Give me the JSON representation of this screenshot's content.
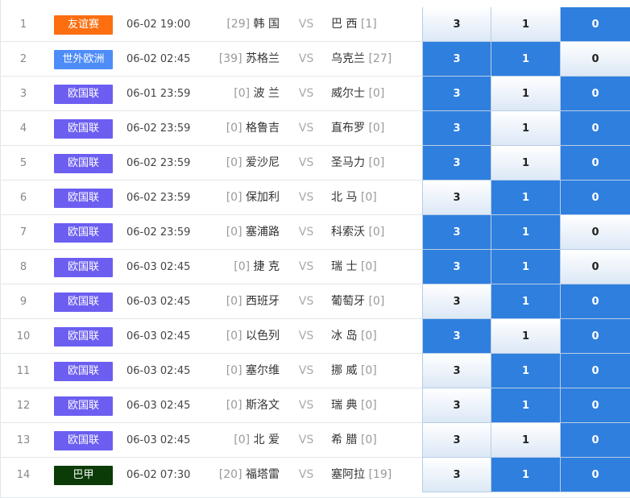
{
  "colors": {
    "friendly": "#fb6f10",
    "world_europe": "#4e8cf8",
    "nations_league": "#6b5ef0",
    "brazil_a": "#0b3b06",
    "odds_selected": "#2f7fde"
  },
  "matches": [
    {
      "num": "1",
      "league": "友谊赛",
      "league_color": "#fb6f10",
      "time": "06-02 19:00",
      "home_rank": "[29]",
      "home": "韩 国",
      "vs": "VS",
      "away": "巴 西",
      "away_rank": "[1]",
      "odds": [
        "3",
        "1",
        "0"
      ],
      "selected": [
        "0"
      ]
    },
    {
      "num": "2",
      "league": "世外欧洲",
      "league_color": "#4e8cf8",
      "time": "06-02 02:45",
      "home_rank": "[39]",
      "home": "苏格兰",
      "vs": "VS",
      "away": "乌克兰",
      "away_rank": "[27]",
      "odds": [
        "3",
        "1",
        "0"
      ],
      "selected": [
        "3",
        "1"
      ]
    },
    {
      "num": "3",
      "league": "欧国联",
      "league_color": "#6b5ef0",
      "time": "06-01 23:59",
      "home_rank": "[0]",
      "home": "波 兰",
      "vs": "VS",
      "away": "威尔士",
      "away_rank": "[0]",
      "odds": [
        "3",
        "1",
        "0"
      ],
      "selected": [
        "3",
        "0"
      ]
    },
    {
      "num": "4",
      "league": "欧国联",
      "league_color": "#6b5ef0",
      "time": "06-02 23:59",
      "home_rank": "[0]",
      "home": "格鲁吉",
      "vs": "VS",
      "away": "直布罗",
      "away_rank": "[0]",
      "odds": [
        "3",
        "1",
        "0"
      ],
      "selected": [
        "3",
        "0"
      ]
    },
    {
      "num": "5",
      "league": "欧国联",
      "league_color": "#6b5ef0",
      "time": "06-02 23:59",
      "home_rank": "[0]",
      "home": "爱沙尼",
      "vs": "VS",
      "away": "圣马力",
      "away_rank": "[0]",
      "odds": [
        "3",
        "1",
        "0"
      ],
      "selected": [
        "3",
        "0"
      ]
    },
    {
      "num": "6",
      "league": "欧国联",
      "league_color": "#6b5ef0",
      "time": "06-02 23:59",
      "home_rank": "[0]",
      "home": "保加利",
      "vs": "VS",
      "away": "北 马",
      "away_rank": "[0]",
      "odds": [
        "3",
        "1",
        "0"
      ],
      "selected": [
        "1",
        "0"
      ]
    },
    {
      "num": "7",
      "league": "欧国联",
      "league_color": "#6b5ef0",
      "time": "06-02 23:59",
      "home_rank": "[0]",
      "home": "塞浦路",
      "vs": "VS",
      "away": "科索沃",
      "away_rank": "[0]",
      "odds": [
        "3",
        "1",
        "0"
      ],
      "selected": [
        "3",
        "1"
      ]
    },
    {
      "num": "8",
      "league": "欧国联",
      "league_color": "#6b5ef0",
      "time": "06-03 02:45",
      "home_rank": "[0]",
      "home": "捷 克",
      "vs": "VS",
      "away": "瑞 士",
      "away_rank": "[0]",
      "odds": [
        "3",
        "1",
        "0"
      ],
      "selected": [
        "3",
        "1"
      ]
    },
    {
      "num": "9",
      "league": "欧国联",
      "league_color": "#6b5ef0",
      "time": "06-03 02:45",
      "home_rank": "[0]",
      "home": "西班牙",
      "vs": "VS",
      "away": "葡萄牙",
      "away_rank": "[0]",
      "odds": [
        "3",
        "1",
        "0"
      ],
      "selected": [
        "1",
        "0"
      ]
    },
    {
      "num": "10",
      "league": "欧国联",
      "league_color": "#6b5ef0",
      "time": "06-03 02:45",
      "home_rank": "[0]",
      "home": "以色列",
      "vs": "VS",
      "away": "冰 岛",
      "away_rank": "[0]",
      "odds": [
        "3",
        "1",
        "0"
      ],
      "selected": [
        "3",
        "0"
      ]
    },
    {
      "num": "11",
      "league": "欧国联",
      "league_color": "#6b5ef0",
      "time": "06-03 02:45",
      "home_rank": "[0]",
      "home": "塞尔维",
      "vs": "VS",
      "away": "挪 威",
      "away_rank": "[0]",
      "odds": [
        "3",
        "1",
        "0"
      ],
      "selected": [
        "1",
        "0"
      ]
    },
    {
      "num": "12",
      "league": "欧国联",
      "league_color": "#6b5ef0",
      "time": "06-03 02:45",
      "home_rank": "[0]",
      "home": "斯洛文",
      "vs": "VS",
      "away": "瑞 典",
      "away_rank": "[0]",
      "odds": [
        "3",
        "1",
        "0"
      ],
      "selected": [
        "1",
        "0"
      ]
    },
    {
      "num": "13",
      "league": "欧国联",
      "league_color": "#6b5ef0",
      "time": "06-03 02:45",
      "home_rank": "[0]",
      "home": "北 爱",
      "vs": "VS",
      "away": "希 腊",
      "away_rank": "[0]",
      "odds": [
        "3",
        "1",
        "0"
      ],
      "selected": [
        "0"
      ]
    },
    {
      "num": "14",
      "league": "巴甲",
      "league_color": "#0b3b06",
      "time": "06-02 07:30",
      "home_rank": "[20]",
      "home": "福塔雷",
      "vs": "VS",
      "away": "塞阿拉",
      "away_rank": "[19]",
      "odds": [
        "3",
        "1",
        "0"
      ],
      "selected": [
        "1",
        "0"
      ]
    }
  ]
}
